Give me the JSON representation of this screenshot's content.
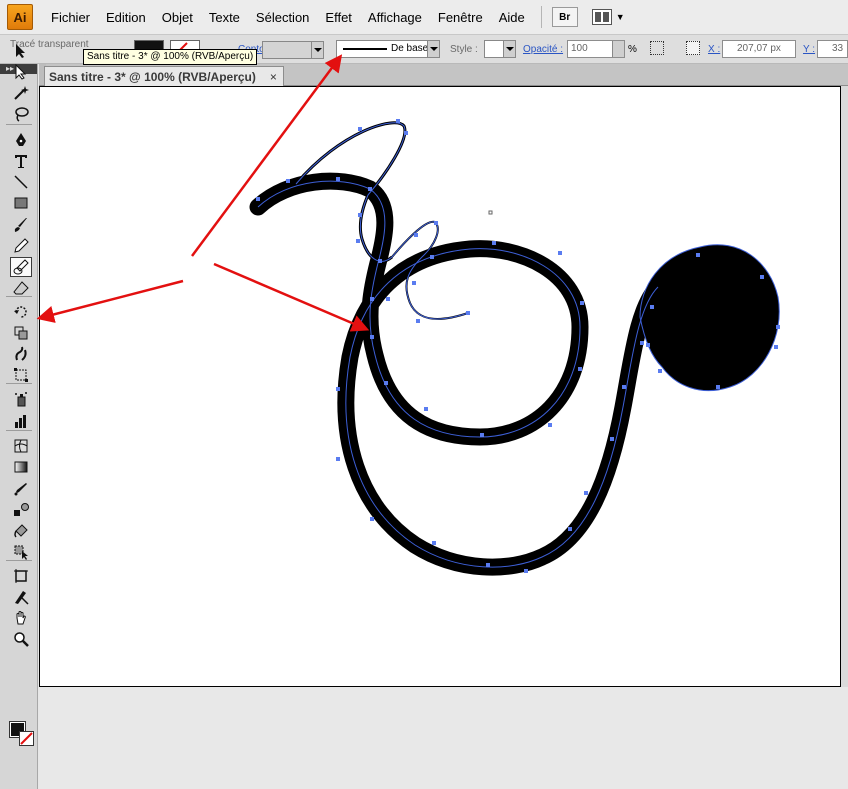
{
  "app": {
    "logo": "Ai"
  },
  "menu": [
    "Fichier",
    "Edition",
    "Objet",
    "Texte",
    "Sélection",
    "Effet",
    "Affichage",
    "Fenêtre",
    "Aide"
  ],
  "bridge_label": "Br",
  "control": {
    "selection_label": "Tracé transparent",
    "contour_label": "Contour",
    "stroke_profile": "De base",
    "style_label": "Style :",
    "opacity_label": "Opacité :",
    "opacity_value": "100",
    "opacity_unit": "%",
    "x_label": "X :",
    "x_value": "207,07 px",
    "y_label": "Y :",
    "y_value": "33"
  },
  "tooltip": "Sans titre - 3* @ 100% (RVB/Aperçu)",
  "document_tab": {
    "title": "Sans titre - 3* @ 100% (RVB/Aperçu)",
    "close": "×"
  },
  "toolbar_grip": "▸▸",
  "tools": [
    {
      "name": "selection-tool",
      "icon": "arrow-icon"
    },
    {
      "name": "direct-selection-tool",
      "icon": "white-arrow-icon"
    },
    {
      "name": "magic-wand-tool",
      "icon": "magic-wand-icon"
    },
    {
      "name": "lasso-tool",
      "icon": "lasso-icon"
    },
    {
      "name": "pen-tool",
      "icon": "pen-icon"
    },
    {
      "name": "type-tool",
      "icon": "type-icon"
    },
    {
      "name": "line-tool",
      "icon": "line-icon"
    },
    {
      "name": "rectangle-tool",
      "icon": "rectangle-icon"
    },
    {
      "name": "paintbrush-tool",
      "icon": "brush-icon"
    },
    {
      "name": "pencil-tool",
      "icon": "pencil-icon"
    },
    {
      "name": "blob-brush-tool",
      "icon": "blob-brush-icon"
    },
    {
      "name": "eraser-tool",
      "icon": "eraser-icon"
    },
    {
      "name": "rotate-tool",
      "icon": "rotate-icon"
    },
    {
      "name": "scale-tool",
      "icon": "scale-icon"
    },
    {
      "name": "warp-tool",
      "icon": "warp-icon"
    },
    {
      "name": "free-transform-tool",
      "icon": "free-transform-icon"
    },
    {
      "name": "symbol-sprayer-tool",
      "icon": "sprayer-icon"
    },
    {
      "name": "graph-tool",
      "icon": "graph-icon"
    },
    {
      "name": "mesh-tool",
      "icon": "mesh-icon"
    },
    {
      "name": "gradient-tool",
      "icon": "gradient-icon"
    },
    {
      "name": "eyedropper-tool",
      "icon": "eyedropper-icon"
    },
    {
      "name": "blend-tool",
      "icon": "blend-icon"
    },
    {
      "name": "live-paint-tool",
      "icon": "live-paint-icon"
    },
    {
      "name": "live-paint-selection-tool",
      "icon": "live-paint-select-icon"
    },
    {
      "name": "artboard-tool",
      "icon": "artboard-icon"
    },
    {
      "name": "slice-tool",
      "icon": "slice-icon"
    },
    {
      "name": "hand-tool",
      "icon": "hand-icon"
    },
    {
      "name": "zoom-tool",
      "icon": "zoom-icon"
    }
  ],
  "colors": {
    "path_selection": "#3d5fd6",
    "annotation_arrow": "#e31010",
    "ink": "#000000"
  }
}
